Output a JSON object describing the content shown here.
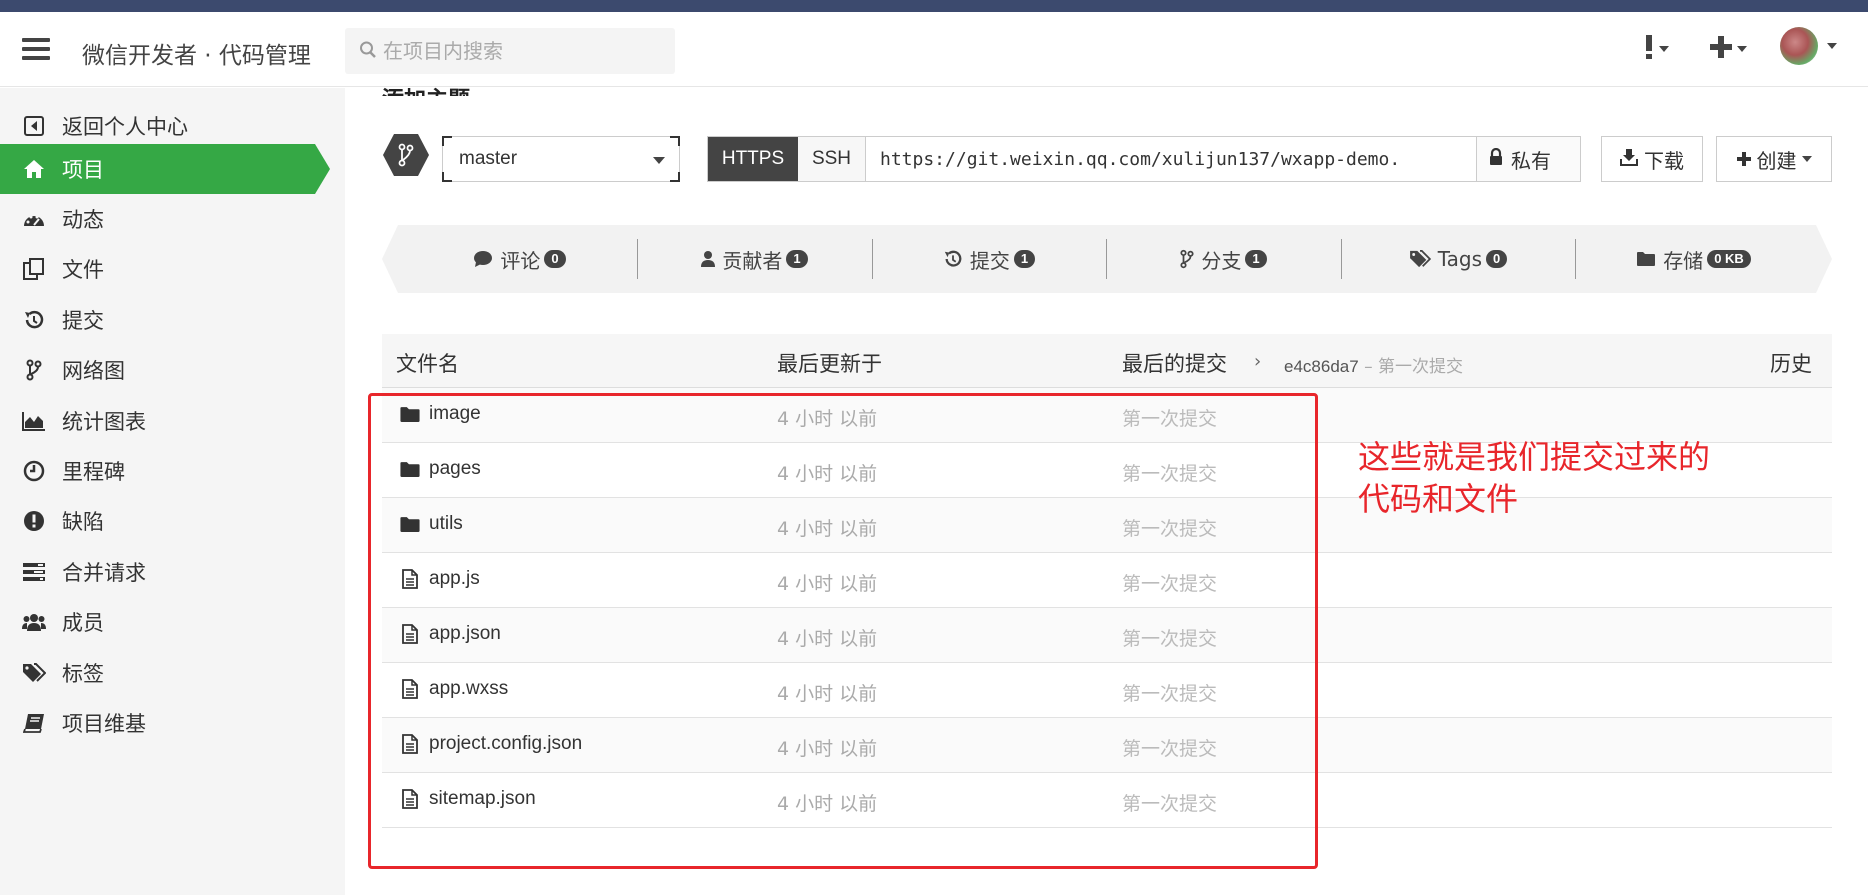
{
  "topbar": {
    "brand": "微信开发者 · 代码管理",
    "search_placeholder": "在项目内搜索"
  },
  "sidebar": {
    "items": [
      {
        "label": "返回个人中心",
        "icon": "back-square-icon"
      },
      {
        "label": "项目",
        "icon": "home-icon",
        "active": true
      },
      {
        "label": "动态",
        "icon": "dashboard-icon"
      },
      {
        "label": "文件",
        "icon": "files-icon"
      },
      {
        "label": "提交",
        "icon": "history-icon"
      },
      {
        "label": "网络图",
        "icon": "branch-icon"
      },
      {
        "label": "统计图表",
        "icon": "area-chart-icon"
      },
      {
        "label": "里程碑",
        "icon": "clock-icon"
      },
      {
        "label": "缺陷",
        "icon": "exclamation-icon"
      },
      {
        "label": "合并请求",
        "icon": "tasks-icon"
      },
      {
        "label": "成员",
        "icon": "users-icon"
      },
      {
        "label": "标签",
        "icon": "tags-icon"
      },
      {
        "label": "项目维基",
        "icon": "book-icon"
      }
    ]
  },
  "repo": {
    "title_partial": "添加主题",
    "branch": "master",
    "https_label": "HTTPS",
    "ssh_label": "SSH",
    "clone_url": "https://git.weixin.qq.com/xulijun137/wxapp-demo.",
    "visibility": "私有",
    "download_label": "下载",
    "create_label": "创建"
  },
  "stats": [
    {
      "label": "评论",
      "count": "0",
      "icon": "comment-icon"
    },
    {
      "label": "贡献者",
      "count": "1",
      "icon": "user-icon"
    },
    {
      "label": "提交",
      "count": "1",
      "icon": "history-icon"
    },
    {
      "label": "分支",
      "count": "1",
      "icon": "branch-icon"
    },
    {
      "label": "Tags",
      "count": "0",
      "icon": "tags-icon"
    },
    {
      "label": "存储",
      "count": "0 KB",
      "icon": "folder-icon"
    }
  ],
  "table": {
    "headers": {
      "name": "文件名",
      "updated": "最后更新于",
      "last_commit": "最后的提交",
      "commit_hash": "e4c86da7",
      "commit_sep": " – ",
      "commit_msg": "第一次提交",
      "history": "历史"
    },
    "rows": [
      {
        "name": "image",
        "type": "folder",
        "time": "4 小时 以前",
        "commit": "第一次提交"
      },
      {
        "name": "pages",
        "type": "folder",
        "time": "4 小时 以前",
        "commit": "第一次提交"
      },
      {
        "name": "utils",
        "type": "folder",
        "time": "4 小时 以前",
        "commit": "第一次提交"
      },
      {
        "name": "app.js",
        "type": "file",
        "time": "4 小时 以前",
        "commit": "第一次提交"
      },
      {
        "name": "app.json",
        "type": "file",
        "time": "4 小时 以前",
        "commit": "第一次提交"
      },
      {
        "name": "app.wxss",
        "type": "file",
        "time": "4 小时 以前",
        "commit": "第一次提交"
      },
      {
        "name": "project.config.json",
        "type": "file",
        "time": "4 小时 以前",
        "commit": "第一次提交"
      },
      {
        "name": "sitemap.json",
        "type": "file",
        "time": "4 小时 以前",
        "commit": "第一次提交"
      }
    ]
  },
  "annotation": {
    "line1": "这些就是我们提交过来的",
    "line2": "代码和文件"
  },
  "colors": {
    "accent_green": "#35a845",
    "annotation_red": "#e8262b",
    "dark_button": "#444444"
  }
}
